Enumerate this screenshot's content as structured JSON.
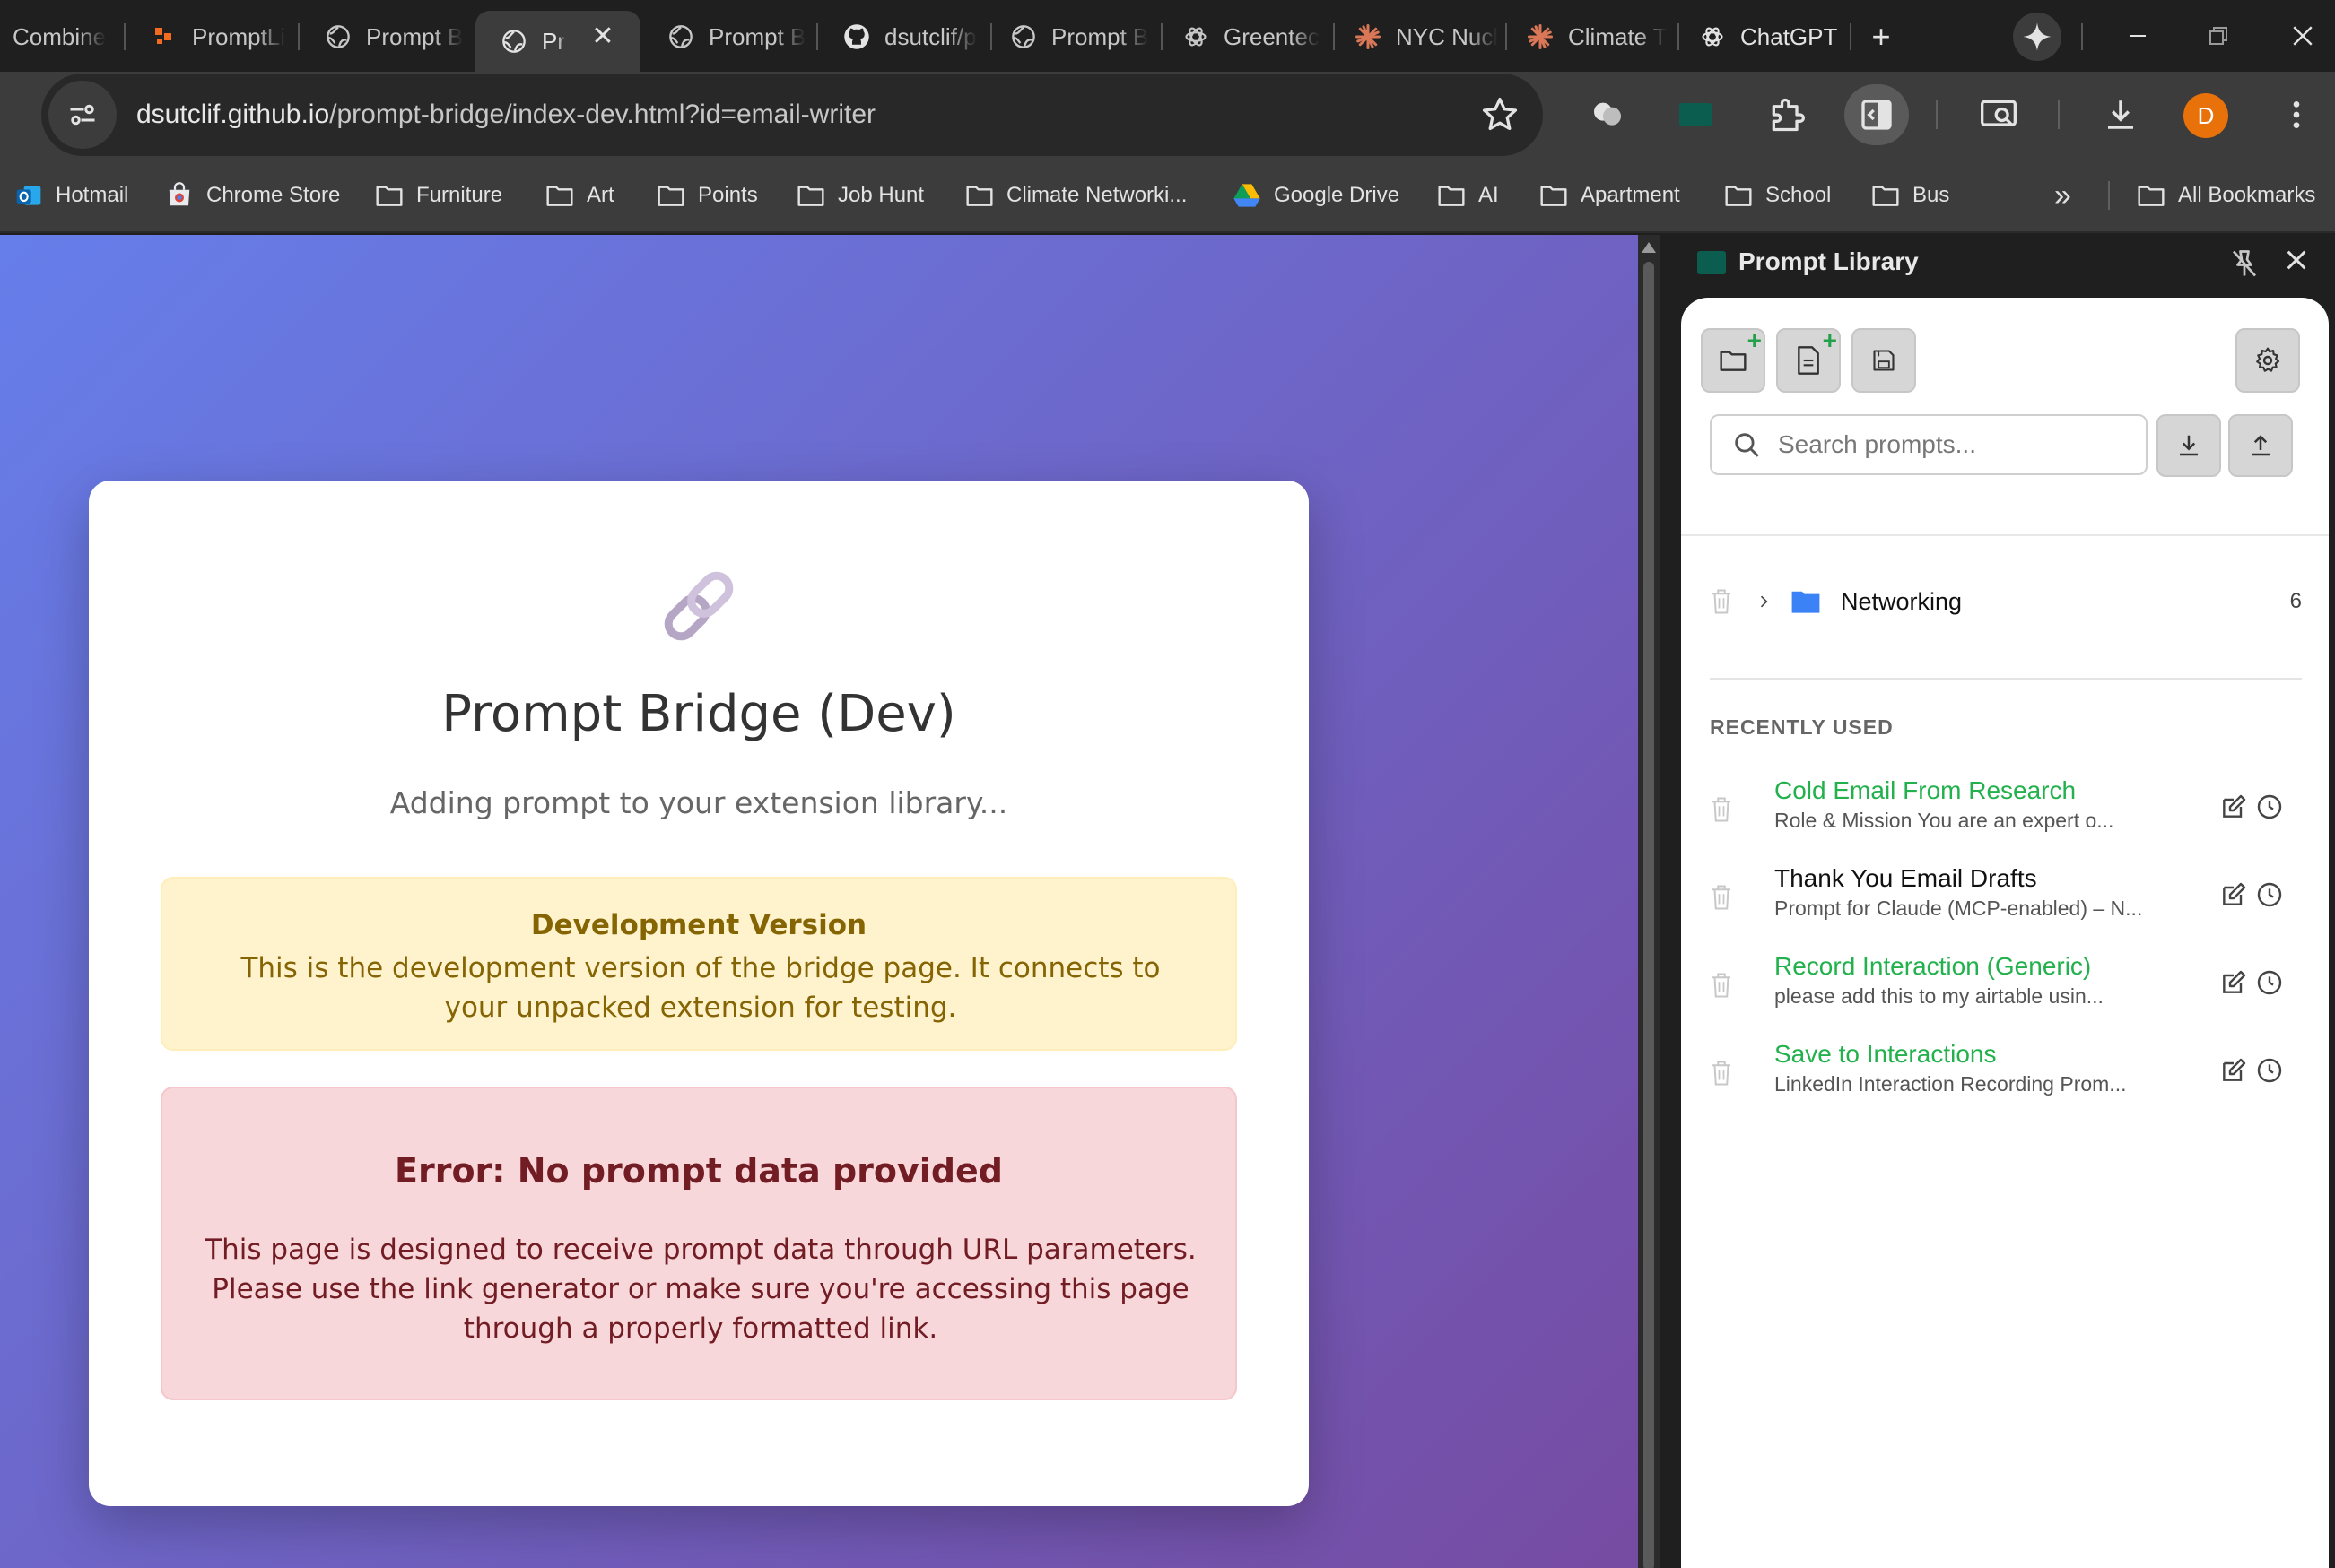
{
  "browser": {
    "tabs": [
      {
        "title": "Combine",
        "icon": "combine-icon"
      },
      {
        "title": "PromptLi",
        "icon": "promptli-icon"
      },
      {
        "title": "Prompt B",
        "icon": "globe-icon"
      },
      {
        "title": "Pr",
        "icon": "globe-icon",
        "active": true
      },
      {
        "title": "Prompt B",
        "icon": "globe-icon"
      },
      {
        "title": "dsutclif/p",
        "icon": "github-icon"
      },
      {
        "title": "Prompt B",
        "icon": "globe-icon"
      },
      {
        "title": "Greentec",
        "icon": "chatgpt-icon"
      },
      {
        "title": "NYC Nucl",
        "icon": "claude-icon"
      },
      {
        "title": "Climate T",
        "icon": "claude-icon"
      },
      {
        "title": "ChatGPT",
        "icon": "chatgpt-icon"
      }
    ],
    "new_tab_symbol": "+",
    "url_host": "dsutclif.github.io",
    "url_path": "/prompt-bridge/index-dev.html?id=email-writer",
    "avatar_letter": "D",
    "bookmarks": [
      {
        "label": "Hotmail",
        "icon": "outlook-icon"
      },
      {
        "label": "Chrome Store",
        "icon": "chrome-store-icon"
      },
      {
        "label": "Furniture",
        "icon": "folder-icon"
      },
      {
        "label": "Art",
        "icon": "folder-icon"
      },
      {
        "label": "Points",
        "icon": "folder-icon"
      },
      {
        "label": "Job Hunt",
        "icon": "folder-icon"
      },
      {
        "label": "Climate Networki...",
        "icon": "folder-icon"
      },
      {
        "label": "Google Drive",
        "icon": "google-drive-icon"
      },
      {
        "label": "AI",
        "icon": "folder-icon"
      },
      {
        "label": "Apartment",
        "icon": "folder-icon"
      },
      {
        "label": "School",
        "icon": "folder-icon"
      },
      {
        "label": "Bus",
        "icon": "folder-icon"
      }
    ],
    "bookmarks_overflow": "»",
    "all_bookmarks": "All Bookmarks"
  },
  "page": {
    "title": "Prompt Bridge (Dev)",
    "subtitle": "Adding prompt to your extension library...",
    "warning_title": "Development Version",
    "warning_text": "This is the development version of the bridge page. It connects to your unpacked extension for testing.",
    "error_title": "Error: No prompt data provided",
    "error_text": "This page is designed to receive prompt data through URL parameters. Please use the link generator or make sure you're accessing this page through a properly formatted link."
  },
  "panel": {
    "title": "Prompt Library",
    "search_placeholder": "Search prompts...",
    "folders": [
      {
        "name": "Networking",
        "count": "6"
      }
    ],
    "recent_heading": "RECENTLY USED",
    "recent": [
      {
        "title": "Cold Email From Research",
        "desc": "Role & Mission You are an expert o...",
        "color": "green"
      },
      {
        "title": "Thank You Email Drafts",
        "desc": "Prompt for Claude (MCP-enabled) – N...",
        "color": "dark"
      },
      {
        "title": "Record Interaction (Generic)",
        "desc": "please add this to my airtable usin...",
        "color": "green"
      },
      {
        "title": "Save to Interactions",
        "desc": "LinkedIn Interaction Recording Prom...",
        "color": "green"
      }
    ]
  },
  "colors": {
    "gradient_start": "#667eea",
    "gradient_end": "#764ba2",
    "accent_green": "#22b14c",
    "warning_bg": "#fff3cd",
    "error_bg": "#f8d7da",
    "avatar": "#e8710a"
  }
}
